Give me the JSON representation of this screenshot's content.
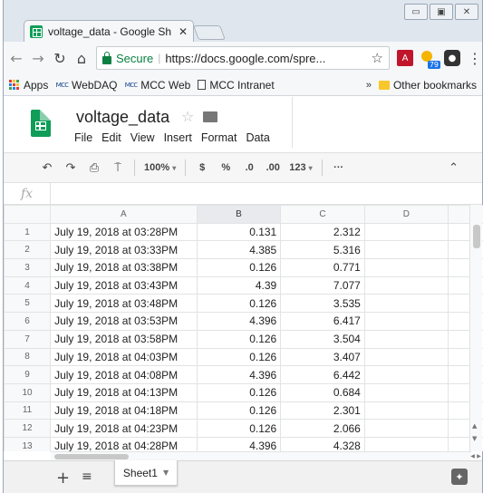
{
  "browser": {
    "tab_title": "voltage_data - Google Sh",
    "tab_close": "✕",
    "window_controls": [
      "▭",
      "▣",
      "✕"
    ],
    "url_secure_label": "Secure",
    "url": "https://docs.google.com/spre...",
    "weather_badge": "79"
  },
  "bookmarks": {
    "apps": "Apps",
    "items": [
      {
        "label": "WebDAQ",
        "icon": "mcc-icon"
      },
      {
        "label": "MCC Web",
        "icon": "mcc-icon"
      },
      {
        "label": "MCC Intranet",
        "icon": "page-icon"
      }
    ],
    "overflow": "»",
    "other": "Other bookmarks"
  },
  "sheets": {
    "title": "voltage_data",
    "menus": [
      "File",
      "Edit",
      "View",
      "Insert",
      "Format",
      "Data"
    ],
    "toolbar": {
      "zoom": "100%",
      "currency": "$",
      "percent": "%",
      "decrease_decimals": ".0",
      "increase_decimals": ".00",
      "more_formats": "123",
      "more": "···"
    },
    "fx": "fx",
    "columns": [
      "A",
      "B",
      "C",
      "D"
    ],
    "rows": [
      {
        "n": "1",
        "a": "July 19, 2018 at 03:28PM",
        "b": "0.131",
        "c": "2.312"
      },
      {
        "n": "2",
        "a": "July 19, 2018 at 03:33PM",
        "b": "4.385",
        "c": "5.316"
      },
      {
        "n": "3",
        "a": "July 19, 2018 at 03:38PM",
        "b": "0.126",
        "c": "0.771"
      },
      {
        "n": "4",
        "a": "July 19, 2018 at 03:43PM",
        "b": "4.39",
        "c": "7.077"
      },
      {
        "n": "5",
        "a": "July 19, 2018 at 03:48PM",
        "b": "0.126",
        "c": "3.535"
      },
      {
        "n": "6",
        "a": "July 19, 2018 at 03:53PM",
        "b": "4.396",
        "c": "6.417"
      },
      {
        "n": "7",
        "a": "July 19, 2018 at 03:58PM",
        "b": "0.126",
        "c": "3.504"
      },
      {
        "n": "8",
        "a": "July 19, 2018 at 04:03PM",
        "b": "0.126",
        "c": "3.407"
      },
      {
        "n": "9",
        "a": "July 19, 2018 at 04:08PM",
        "b": "4.396",
        "c": "6.442"
      },
      {
        "n": "10",
        "a": "July 19, 2018 at 04:13PM",
        "b": "0.126",
        "c": "0.684"
      },
      {
        "n": "11",
        "a": "July 19, 2018 at 04:18PM",
        "b": "0.126",
        "c": "2.301"
      },
      {
        "n": "12",
        "a": "July 19, 2018 at 04:23PM",
        "b": "0.126",
        "c": "2.066"
      },
      {
        "n": "13",
        "a": "July 19, 2018 at 04:28PM",
        "b": "4.396",
        "c": "4.328"
      }
    ],
    "sheet_tab": "Sheet1",
    "add_sheet": "+",
    "all_sheets": "≡"
  },
  "colors": {
    "sheets_green": "#0f9d58",
    "secure_green": "#0b8043",
    "selected_header": "#e8eaed"
  }
}
